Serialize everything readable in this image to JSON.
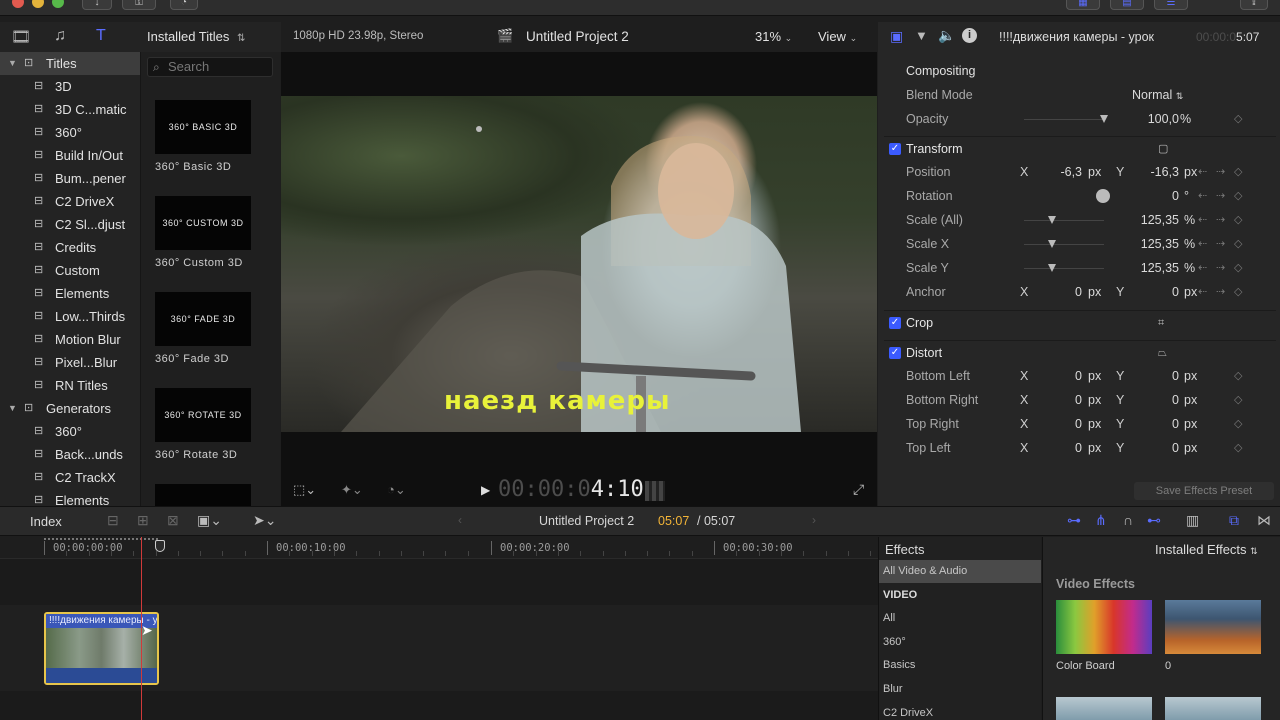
{
  "browser": {
    "dropdown_label": "Installed Titles",
    "search_placeholder": "Search"
  },
  "library": {
    "items": [
      {
        "label": "Titles",
        "kind": "category",
        "expanded": true,
        "selected": true
      },
      {
        "label": "3D"
      },
      {
        "label": "3D C...matic"
      },
      {
        "label": "360°"
      },
      {
        "label": "Build In/Out"
      },
      {
        "label": "Bum...pener"
      },
      {
        "label": "C2 DriveX"
      },
      {
        "label": "C2 Sl...djust"
      },
      {
        "label": "Credits"
      },
      {
        "label": "Custom"
      },
      {
        "label": "Elements"
      },
      {
        "label": "Low...Thirds"
      },
      {
        "label": "Motion Blur"
      },
      {
        "label": "Pixel...Blur"
      },
      {
        "label": "RN Titles"
      },
      {
        "label": "Generators",
        "kind": "category",
        "expanded": true
      },
      {
        "label": "360°"
      },
      {
        "label": "Back...unds"
      },
      {
        "label": "C2 TrackX"
      },
      {
        "label": "Elements"
      }
    ]
  },
  "titles": [
    {
      "card": "360° BASIC 3D",
      "name": "360° Basic 3D"
    },
    {
      "card": "360° CUSTOM 3D",
      "name": "360° Custom 3D"
    },
    {
      "card": "360° FADE 3D",
      "name": "360° Fade 3D"
    },
    {
      "card": "360° ROTATE 3D",
      "name": "360° Rotate 3D"
    }
  ],
  "viewer": {
    "format": "1080p HD 23.98p, Stereo",
    "project": "Untitled Project 2",
    "zoom": "31%",
    "view_label": "View",
    "caption": "наезд камеры",
    "timecode_dim": "00:00:0",
    "timecode_bright": "4:10"
  },
  "inspector": {
    "title": "!!!!движения камеры - урок",
    "duration_dim": "00:00:0",
    "duration_bright": "5:07",
    "compositing": "Compositing",
    "blend_mode_label": "Blend Mode",
    "blend_mode_value": "Normal",
    "opacity_label": "Opacity",
    "opacity_value": "100,0",
    "opacity_unit": "%",
    "opacity_level": 1.0,
    "transform": "Transform",
    "position_label": "Position",
    "position_x": "-6,3",
    "position_y": "-16,3",
    "rotation_label": "Rotation",
    "rotation_value": "0",
    "rotation_unit": "°",
    "scale_all_label": "Scale (All)",
    "scale_all_value": "125,35",
    "scale_x_label": "Scale X",
    "scale_x_value": "125,35",
    "scale_y_label": "Scale Y",
    "scale_y_value": "125,35",
    "scale_unit": "%",
    "anchor_label": "Anchor",
    "anchor_x": "0",
    "anchor_y": "0",
    "crop": "Crop",
    "distort": "Distort",
    "bottom_left": "Bottom Left",
    "bottom_right": "Bottom Right",
    "top_right": "Top Right",
    "top_left": "Top Left",
    "corner_x": "0",
    "corner_y": "0",
    "px": "px",
    "x_axis": "X",
    "y_axis": "Y",
    "save_preset": "Save Effects Preset"
  },
  "timeline": {
    "index_label": "Index",
    "project": "Untitled Project 2",
    "position_time": "05:07",
    "total_time": "/ 05:07",
    "ruler": [
      "00:00:00:00",
      "00:00:10:00",
      "00:00:20:00",
      "00:00:30:00"
    ],
    "clip_title": "!!!!движения камеры - урок"
  },
  "effects": {
    "header": "Effects",
    "dropdown": "Installed Effects",
    "categories": [
      "All Video & Audio",
      "VIDEO",
      "All",
      "360°",
      "Basics",
      "Blur",
      "C2 DriveX"
    ],
    "section": "Video Effects",
    "items": [
      {
        "name": "Color Board"
      },
      {
        "name": "0"
      }
    ]
  },
  "colors": {
    "accent": "#5a6cff",
    "checkbox": "#3b5bff",
    "clip_border": "#e7c54b",
    "caption": "#e8f23a",
    "timecode_bright": "#f2b438",
    "playhead": "#d03a3a"
  }
}
